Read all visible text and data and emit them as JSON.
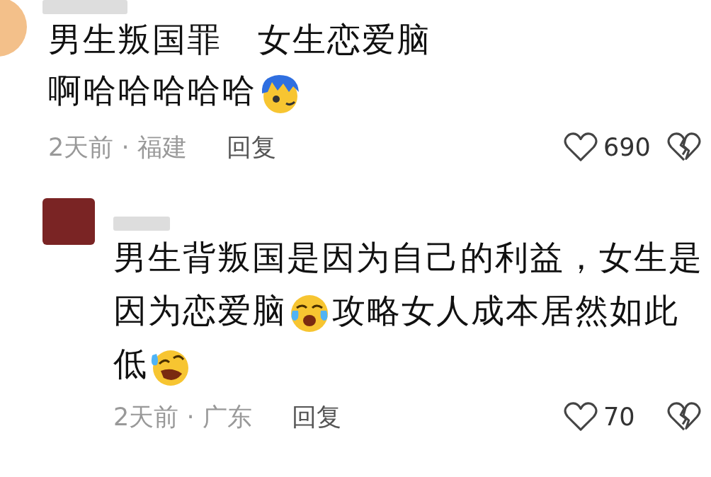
{
  "comments": [
    {
      "kind": "comment",
      "paragraphs": [
        [
          {
            "kind": "text",
            "text": "男生叛国罪   女生恋爱脑"
          }
        ],
        [
          {
            "kind": "text",
            "text": "啊哈哈哈哈哈"
          },
          {
            "kind": "wink"
          }
        ]
      ],
      "meta": "2天前 · 福建",
      "reply": "回复",
      "likes": "690"
    },
    {
      "kind": "reply",
      "paragraphs": [
        [
          {
            "kind": "text",
            "text": "男生背叛国是因为自己的利益，女生是"
          }
        ],
        [
          {
            "kind": "text",
            "text": "因为恋爱脑"
          },
          {
            "kind": "tears"
          },
          {
            "kind": "text",
            "text": "攻略女人成本居然如此"
          }
        ],
        [
          {
            "kind": "text",
            "text": "低"
          },
          {
            "kind": "rofl"
          }
        ]
      ],
      "meta": "2天前 · 广东",
      "reply": "回复",
      "likes": "70"
    }
  ]
}
